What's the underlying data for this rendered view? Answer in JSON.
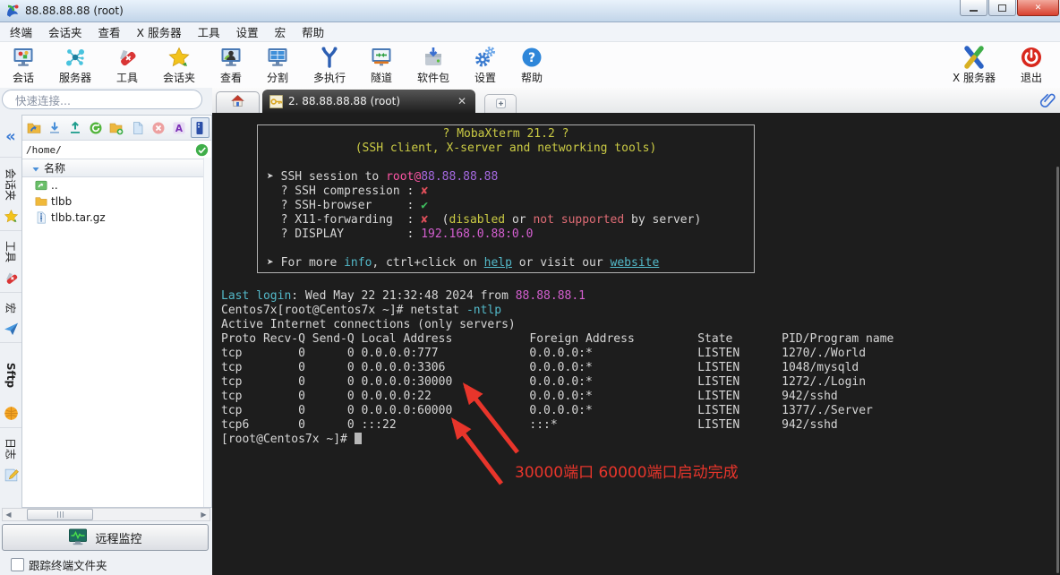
{
  "window": {
    "title": "88.88.88.88 (root)"
  },
  "menu": {
    "items": [
      {
        "label": "终端",
        "name": "terminal"
      },
      {
        "label": "会话夹",
        "name": "sessions"
      },
      {
        "label": "查看",
        "name": "view"
      },
      {
        "label": "X 服务器",
        "name": "x-server"
      },
      {
        "label": "工具",
        "name": "tools"
      },
      {
        "label": "设置",
        "name": "settings"
      },
      {
        "label": "宏",
        "name": "macros"
      },
      {
        "label": "帮助",
        "name": "help"
      }
    ]
  },
  "toolbar": {
    "left": [
      {
        "label": "会话",
        "icon": "session-icon",
        "name": "session"
      },
      {
        "label": "服务器",
        "icon": "servers-icon",
        "name": "servers"
      },
      {
        "label": "工具",
        "icon": "tools-icon",
        "name": "tools"
      },
      {
        "label": "会话夹",
        "icon": "star-icon",
        "name": "sessions-folder"
      },
      {
        "label": "查看",
        "icon": "view-icon",
        "name": "view"
      },
      {
        "label": "分割",
        "icon": "split-icon",
        "name": "split"
      },
      {
        "label": "多执行",
        "icon": "multiexec-icon",
        "name": "multiexec"
      },
      {
        "label": "隧道",
        "icon": "tunnel-icon",
        "name": "tunnel"
      },
      {
        "label": "软件包",
        "icon": "packages-icon",
        "name": "packages"
      },
      {
        "label": "设置",
        "icon": "settings-icon",
        "name": "settings"
      },
      {
        "label": "帮助",
        "icon": "help-icon",
        "name": "help"
      }
    ],
    "right": [
      {
        "label": "X 服务器",
        "icon": "xserver-icon",
        "name": "x-server"
      },
      {
        "label": "退出",
        "icon": "exit-icon",
        "name": "exit"
      }
    ]
  },
  "tabbar": {
    "active_tab": "2. 88.88.88.88 (root)"
  },
  "sidebar": {
    "quick_connect_placeholder": "快速连接...",
    "vertical_tabs": [
      {
        "label": "会话夹",
        "icon": "star-icon",
        "name": "sessions"
      },
      {
        "label": "工具",
        "icon": "knife-icon",
        "name": "tools"
      },
      {
        "label": "宏",
        "icon": "macro-icon",
        "name": "macros"
      },
      {
        "label": "Sftp",
        "icon": "sftp-icon",
        "name": "sftp",
        "bold": true
      },
      {
        "label": "日志",
        "icon": "log-icon",
        "name": "log"
      }
    ],
    "file_browser": {
      "toolbar": [
        {
          "icon": "go-up-icon",
          "name": "go-up"
        },
        {
          "icon": "download-icon",
          "name": "download"
        },
        {
          "icon": "upload-icon",
          "name": "upload"
        },
        {
          "icon": "refresh-icon",
          "name": "refresh"
        },
        {
          "icon": "new-folder-icon",
          "name": "new-folder"
        },
        {
          "icon": "new-file-icon",
          "name": "new-file"
        },
        {
          "icon": "delete-icon",
          "name": "delete"
        },
        {
          "icon": "rename-icon",
          "name": "rename"
        },
        {
          "icon": "sync-panel-icon",
          "name": "sync-panel",
          "active": true
        }
      ],
      "path": "/home/",
      "column_header": "名称",
      "items": [
        {
          "name": "..",
          "type": "up"
        },
        {
          "name": "tlbb",
          "type": "folder"
        },
        {
          "name": "tlbb.tar.gz",
          "type": "archive"
        }
      ]
    },
    "remote_monitor_label": "远程监控",
    "follow_terminal_label": "跟踪终端文件夹"
  },
  "terminal": {
    "banner_lines": [
      {
        "center": true,
        "segs": [
          [
            "y",
            "? MobaXterm 21.2 ?"
          ]
        ]
      },
      {
        "center": true,
        "segs": [
          [
            "y",
            "(SSH client, X-server and networking tools)"
          ]
        ]
      },
      {
        "segs": []
      },
      {
        "segs": [
          [
            "w",
            "➤ SSH session to "
          ],
          [
            "pk",
            "root@"
          ],
          [
            "pu",
            "88.88.88.88"
          ]
        ]
      },
      {
        "segs": [
          [
            "w",
            "  ? SSH compression : "
          ],
          [
            "r",
            "✘"
          ]
        ]
      },
      {
        "segs": [
          [
            "w",
            "  ? SSH-browser     : "
          ],
          [
            "g",
            "✔"
          ]
        ]
      },
      {
        "segs": [
          [
            "w",
            "  ? X11-forwarding  : "
          ],
          [
            "r",
            "✘"
          ],
          [
            "w",
            "  ("
          ],
          [
            "y",
            "disabled"
          ],
          [
            "w",
            " or "
          ],
          [
            "rd",
            "not supported"
          ],
          [
            "w",
            " by server)"
          ]
        ]
      },
      {
        "segs": [
          [
            "w",
            "  ? DISPLAY         : "
          ],
          [
            "m",
            "192.168.0.88:0.0"
          ]
        ]
      },
      {
        "segs": []
      },
      {
        "segs": [
          [
            "w",
            "➤ For more "
          ],
          [
            "c",
            "info"
          ],
          [
            "w",
            ", ctrl+click on "
          ],
          [
            "cu",
            "help"
          ],
          [
            "w",
            " or visit our "
          ],
          [
            "cu",
            "website"
          ]
        ]
      }
    ],
    "body_lines": [
      {
        "segs": [
          [
            "c",
            "Last login"
          ],
          [
            "w",
            ": Wed May 22 21:32:48 2024 from "
          ],
          [
            "m",
            "88.88.88.1"
          ]
        ]
      },
      {
        "segs": [
          [
            "w",
            "Centos7x[root@Centos7x ~]# netstat "
          ],
          [
            "c",
            "-ntlp"
          ]
        ]
      },
      {
        "segs": [
          [
            "w",
            "Active Internet connections (only servers)"
          ]
        ]
      },
      {
        "segs": [
          [
            "w",
            "Proto Recv-Q Send-Q Local Address           Foreign Address         State       PID/Program name"
          ]
        ]
      },
      {
        "segs": [
          [
            "w",
            "tcp        0      0 0.0.0.0:777             0.0.0.0:*               LISTEN      1270/./World"
          ]
        ]
      },
      {
        "segs": [
          [
            "w",
            "tcp        0      0 0.0.0.0:3306            0.0.0.0:*               LISTEN      1048/mysqld"
          ]
        ]
      },
      {
        "segs": [
          [
            "w",
            "tcp        0      0 0.0.0.0:30000           0.0.0.0:*               LISTEN      1272/./Login"
          ]
        ]
      },
      {
        "segs": [
          [
            "w",
            "tcp        0      0 0.0.0.0:22              0.0.0.0:*               LISTEN      942/sshd"
          ]
        ]
      },
      {
        "segs": [
          [
            "w",
            "tcp        0      0 0.0.0.0:60000           0.0.0.0:*               LISTEN      1377/./Server"
          ]
        ]
      },
      {
        "segs": [
          [
            "w",
            "tcp6       0      0 :::22                   :::*                    LISTEN      942/sshd"
          ]
        ]
      },
      {
        "segs": [
          [
            "w",
            "[root@Centos7x ~]# "
          ],
          [
            "cursor",
            ""
          ]
        ]
      }
    ],
    "annotation": "30000端口 60000端口启动完成"
  },
  "colors": {
    "terminal_bg": "#1d1d1d",
    "annotation_red": "#e8352b",
    "banner_yellow": "#cbcb44",
    "link_cyan": "#53b9c9",
    "ip_magenta": "#d45fd0",
    "check_green": "#3fbf5f",
    "cross_red": "#e04f5a"
  }
}
